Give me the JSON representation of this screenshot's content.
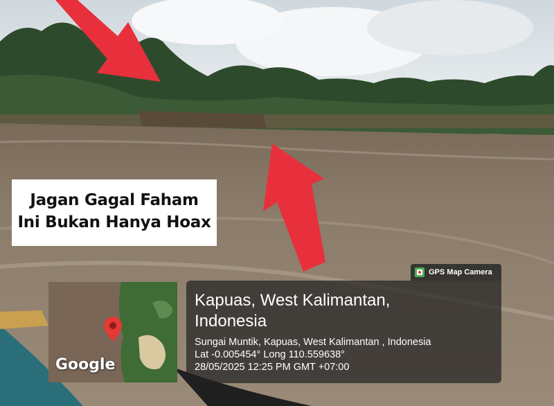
{
  "caption": {
    "line1": "Jagan Gagal Faham",
    "line2": "Ini Bukan Hanya Hoax"
  },
  "gps_camera": {
    "app_name": "GPS Map Camera",
    "map_brand": "Google",
    "location_title": [
      "Kapuas, West Kalimantan,",
      "Indonesia"
    ],
    "address": "Sungai Muntik, Kapuas, West Kalimantan , Indonesia",
    "coordinates": "Lat -0.005454° Long 110.559638°",
    "datetime": "28/05/2025 12:25 PM GMT +07:00"
  },
  "colors": {
    "arrow": "#e8303c",
    "map_pin": "#e53935",
    "panel_bg": "#232323"
  },
  "icons": [
    "arrow-icon",
    "map-pin-icon",
    "gps-map-camera-icon"
  ]
}
